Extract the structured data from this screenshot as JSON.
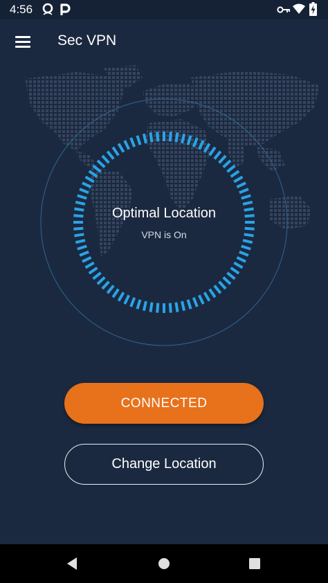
{
  "status_bar": {
    "time": "4:56",
    "left_icons": [
      "opera-icon",
      "parking-p-icon"
    ],
    "right_icons": [
      "vpn-key-icon",
      "wifi-icon",
      "battery-charging-icon"
    ]
  },
  "app_bar": {
    "title": "Sec VPN",
    "menu_icon": "hamburger-menu-icon"
  },
  "dial": {
    "title": "Optimal Location",
    "status": "VPN is On",
    "accent_color": "#2aa3e6"
  },
  "buttons": {
    "connect_label": "CONNECTED",
    "connect_color": "#e8711b",
    "change_location_label": "Change Location"
  },
  "nav_bar": {
    "icons": [
      "back-icon",
      "home-icon",
      "recents-icon"
    ]
  },
  "colors": {
    "background": "#1b2940",
    "status_bar": "#152236",
    "nav_bar": "#000000"
  }
}
